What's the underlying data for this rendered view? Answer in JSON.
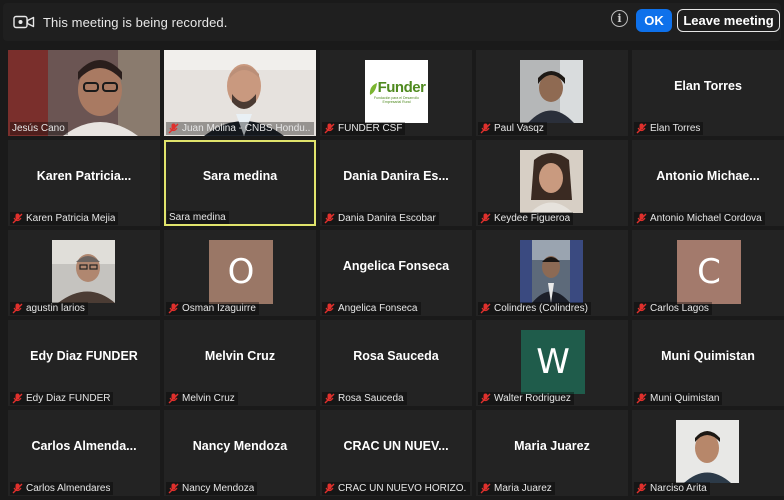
{
  "recording_bar": {
    "message": "This meeting is being recorded.",
    "info": "i",
    "ok_label": "OK",
    "leave_label": "Leave meeting"
  },
  "colors": {
    "ok_button": "#0e71eb",
    "active_speaker_border": "#e0e36b",
    "tile_bg": "#232323",
    "mute_icon": "#e0302c",
    "avatar_o": "#9a7766",
    "avatar_c": "#a37a6c",
    "avatar_w": "#1f5c4b"
  },
  "participants": [
    {
      "label": "Jesús Cano",
      "tile_name": "",
      "muted": false,
      "video": "photo"
    },
    {
      "label": "Juan Molina - CNBS Hondu...",
      "tile_name": "",
      "muted": true,
      "video": "photo"
    },
    {
      "label": "FUNDER CSF",
      "tile_name": "",
      "muted": true,
      "video": "logo",
      "logo_text": "Funder",
      "logo_sub": "Fundación para el Desarrollo Empresarial Rural"
    },
    {
      "label": "Paul Vasqz",
      "tile_name": "",
      "muted": true,
      "video": "photo"
    },
    {
      "label": "Elan Torres",
      "tile_name": "Elan Torres",
      "muted": true,
      "video": "none"
    },
    {
      "label": "Karen Patricia Mejia",
      "tile_name": "Karen  Patricia...",
      "muted": true,
      "video": "none"
    },
    {
      "label": "Sara medina",
      "tile_name": "Sara medina",
      "muted": false,
      "video": "none",
      "active": true
    },
    {
      "label": "Dania Danira Escobar",
      "tile_name": "Dania  Danira  Es...",
      "muted": true,
      "video": "none"
    },
    {
      "label": "Keydee Figueroa",
      "tile_name": "",
      "muted": true,
      "video": "photo"
    },
    {
      "label": "Antonio Michael Cordova",
      "tile_name": "Antonio  Michae...",
      "muted": true,
      "video": "none"
    },
    {
      "label": "agustin larios",
      "tile_name": "",
      "muted": true,
      "video": "photo"
    },
    {
      "label": "Osman Izaguirre",
      "tile_name": "",
      "muted": true,
      "video": "avatar",
      "initial": "O"
    },
    {
      "label": "Angelica Fonseca",
      "tile_name": "Angelica Fonseca",
      "muted": true,
      "video": "none"
    },
    {
      "label": "Colindres (Colindres)",
      "tile_name": "",
      "muted": true,
      "video": "photo"
    },
    {
      "label": "Carlos Lagos",
      "tile_name": "",
      "muted": true,
      "video": "avatar",
      "initial": "C"
    },
    {
      "label": "Edy Diaz FUNDER",
      "tile_name": "Edy Diaz FUNDER",
      "muted": true,
      "video": "none"
    },
    {
      "label": "Melvin Cruz",
      "tile_name": "Melvin Cruz",
      "muted": true,
      "video": "none"
    },
    {
      "label": "Rosa Sauceda",
      "tile_name": "Rosa Sauceda",
      "muted": true,
      "video": "none"
    },
    {
      "label": "Walter Rodriguez",
      "tile_name": "",
      "muted": true,
      "video": "avatar",
      "initial": "W"
    },
    {
      "label": "Muni Quimistan",
      "tile_name": "Muni Quimistan",
      "muted": true,
      "video": "none"
    },
    {
      "label": "Carlos Almendares",
      "tile_name": "Carlos  Almenda...",
      "muted": true,
      "video": "none"
    },
    {
      "label": "Nancy Mendoza",
      "tile_name": "Nancy Mendoza",
      "muted": true,
      "video": "none"
    },
    {
      "label": "CRAC UN NUEVO HORIZO...",
      "tile_name": "CRAC UN NUEV...",
      "muted": true,
      "video": "none"
    },
    {
      "label": "Maria Juarez",
      "tile_name": "Maria Juarez",
      "muted": true,
      "video": "none"
    },
    {
      "label": "Narciso Arita",
      "tile_name": "",
      "muted": true,
      "video": "photo"
    }
  ]
}
